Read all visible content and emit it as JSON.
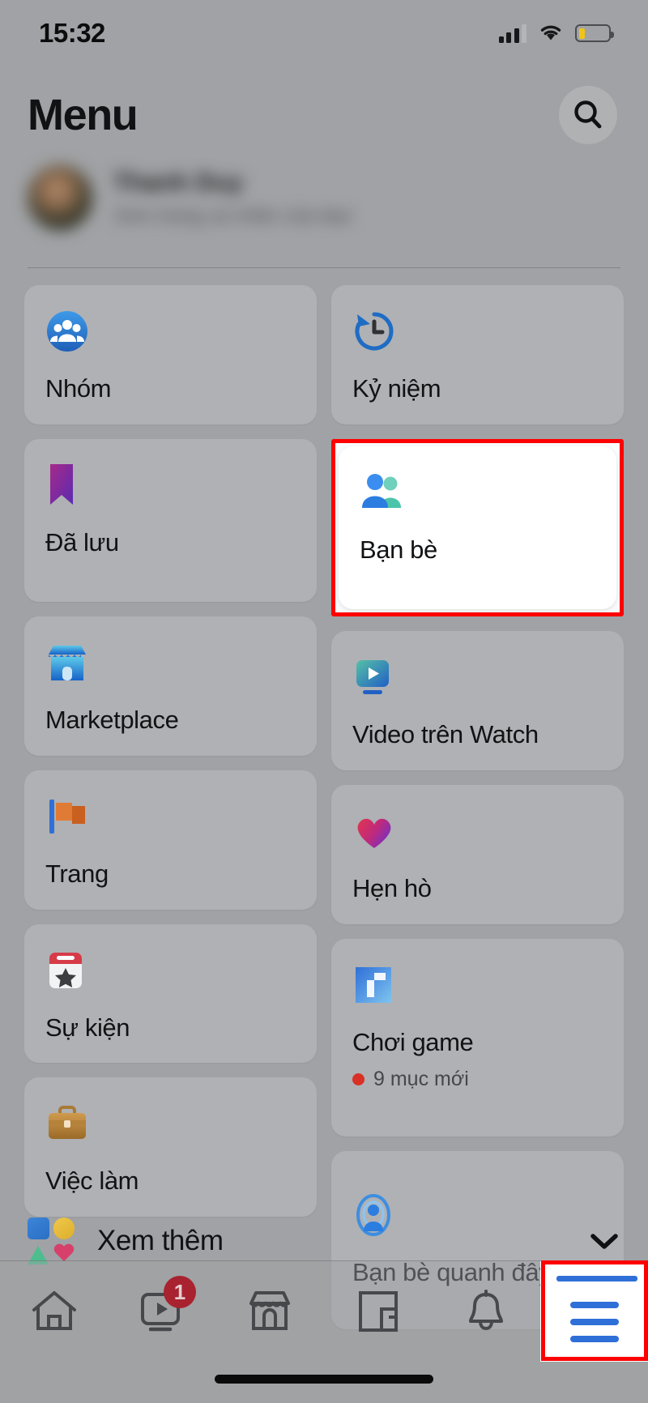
{
  "status_bar": {
    "time": "15:32",
    "signal_icon": "cellular-signal-icon",
    "wifi_icon": "wifi-icon",
    "battery_icon": "battery-low-icon"
  },
  "header": {
    "title": "Menu",
    "search_icon": "search-icon"
  },
  "profile": {
    "name": "Thanh Duy",
    "subtitle": "Xem trang cá nhân của bạn",
    "avatar_icon": "avatar"
  },
  "menu_grid": {
    "left_column": [
      {
        "label": "Nhóm",
        "icon": "groups-icon"
      },
      {
        "label": "Đã lưu",
        "icon": "bookmark-icon"
      },
      {
        "label": "Marketplace",
        "icon": "storefront-icon"
      },
      {
        "label": "Trang",
        "icon": "pages-flag-icon"
      },
      {
        "label": "Sự kiện",
        "icon": "calendar-star-icon"
      },
      {
        "label": "Việc làm",
        "icon": "briefcase-icon"
      }
    ],
    "right_column": [
      {
        "label": "Kỷ niệm",
        "icon": "memories-clock-icon"
      },
      {
        "label": "Bạn bè",
        "icon": "friends-icon",
        "active": true
      },
      {
        "label": "Video trên Watch",
        "icon": "watch-play-icon"
      },
      {
        "label": "Hẹn hò",
        "icon": "dating-heart-icon"
      },
      {
        "label": "Chơi game",
        "icon": "gaming-icon",
        "sub": "9 mục mới"
      },
      {
        "label": "Bạn bè quanh đây",
        "icon": "nearby-friends-icon"
      }
    ]
  },
  "see_more": {
    "label": "Xem thêm",
    "icon": "shapes-icon",
    "chevron_icon": "chevron-down-icon"
  },
  "bottom_nav": {
    "items": [
      {
        "name": "home",
        "icon": "home-icon"
      },
      {
        "name": "watch",
        "icon": "watch-icon",
        "badge": "1"
      },
      {
        "name": "marketplace",
        "icon": "marketplace-icon"
      },
      {
        "name": "gaming",
        "icon": "gaming-icon"
      },
      {
        "name": "notifications",
        "icon": "bell-icon"
      },
      {
        "name": "menu",
        "icon": "hamburger-menu-icon",
        "active": true
      }
    ]
  },
  "colors": {
    "accent_blue": "#2f6fd8",
    "badge_red": "#a8232f",
    "dot_red": "#d93025",
    "highlight_border": "#ff0000",
    "background": "#a0a2a5",
    "tile": "#b8babd"
  }
}
